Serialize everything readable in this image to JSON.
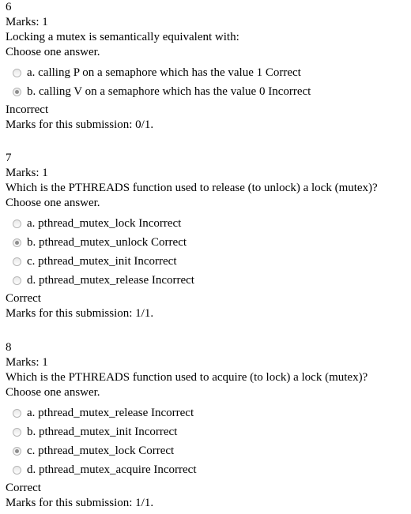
{
  "questions": [
    {
      "number": "6",
      "marks": "Marks: 1",
      "text": "Locking a mutex is semantically equivalent with:",
      "prompt": "Choose one answer.",
      "answers": [
        {
          "label": "a. calling P on a semaphore which has the value 1 Correct",
          "selected": false
        },
        {
          "label": "b. calling V on a semaphore which has the value 0 Incorrect",
          "selected": true
        }
      ],
      "result": "Incorrect",
      "submission": "Marks for this submission: 0/1."
    },
    {
      "number": "7",
      "marks": "Marks: 1",
      "text": "Which is the PTHREADS function used to release (to unlock) a lock (mutex)?",
      "prompt": "Choose one answer.",
      "answers": [
        {
          "label": "a. pthread_mutex_lock Incorrect",
          "selected": false
        },
        {
          "label": "b. pthread_mutex_unlock Correct",
          "selected": true
        },
        {
          "label": "c. pthread_mutex_init Incorrect",
          "selected": false
        },
        {
          "label": "d. pthread_mutex_release Incorrect",
          "selected": false
        }
      ],
      "result": "Correct",
      "submission": "Marks for this submission: 1/1."
    },
    {
      "number": "8",
      "marks": "Marks: 1",
      "text": "Which is the PTHREADS function used to acquire (to lock) a lock (mutex)?",
      "prompt": "Choose one answer.",
      "answers": [
        {
          "label": "a. pthread_mutex_release Incorrect",
          "selected": false
        },
        {
          "label": "b. pthread_mutex_init Incorrect",
          "selected": false
        },
        {
          "label": "c. pthread_mutex_lock Correct",
          "selected": true
        },
        {
          "label": "d. pthread_mutex_acquire Incorrect",
          "selected": false
        }
      ],
      "result": "Correct",
      "submission": "Marks for this submission: 1/1."
    }
  ]
}
